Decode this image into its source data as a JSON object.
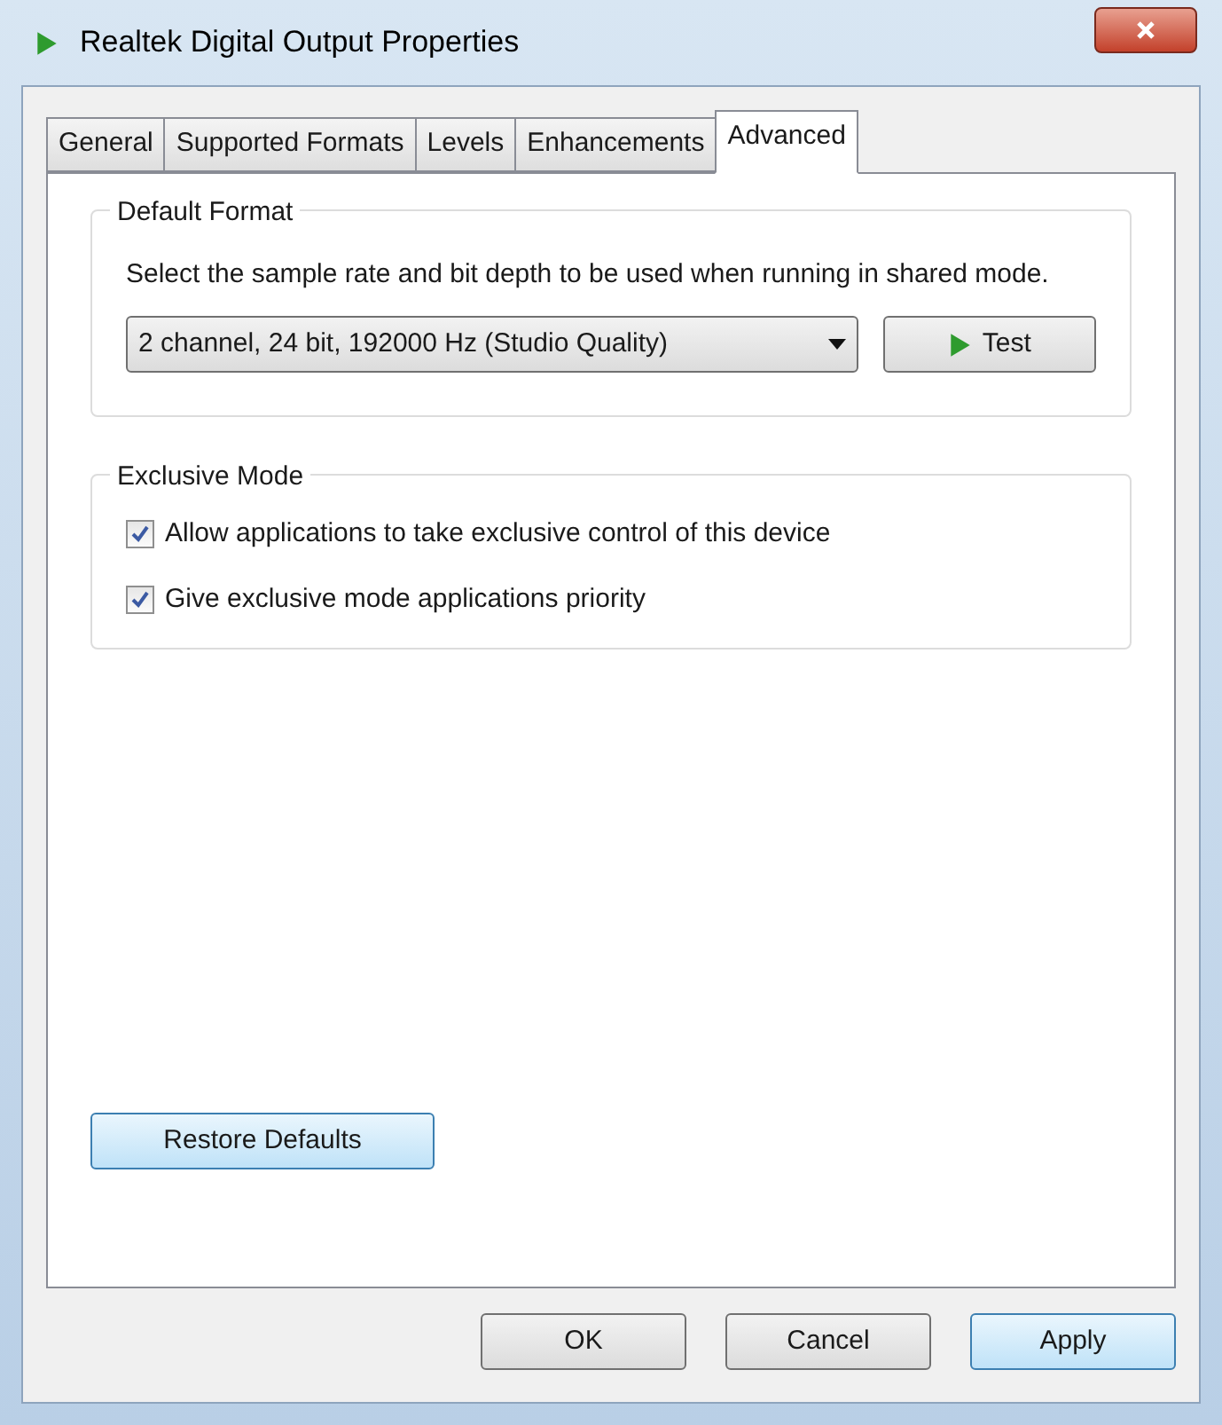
{
  "window": {
    "title": "Realtek Digital Output Properties"
  },
  "tabs": [
    {
      "label": "General",
      "selected": false
    },
    {
      "label": "Supported Formats",
      "selected": false
    },
    {
      "label": "Levels",
      "selected": false
    },
    {
      "label": "Enhancements",
      "selected": false
    },
    {
      "label": "Advanced",
      "selected": true
    }
  ],
  "default_format": {
    "title": "Default Format",
    "description": "Select the sample rate and bit depth to be used when running in shared mode.",
    "format_value": "2 channel, 24 bit, 192000 Hz (Studio Quality)",
    "test_button": "Test"
  },
  "exclusive_mode": {
    "title": "Exclusive Mode",
    "options": [
      {
        "label": "Allow applications to take exclusive control of this device",
        "checked": true
      },
      {
        "label": "Give exclusive mode applications priority",
        "checked": true
      }
    ]
  },
  "restore_button": {
    "label": "Restore Defaults",
    "highlighted": true
  },
  "buttons": [
    {
      "label": "OK",
      "highlighted": false
    },
    {
      "label": "Cancel",
      "highlighted": false
    },
    {
      "label": "Apply",
      "highlighted": true
    }
  ]
}
